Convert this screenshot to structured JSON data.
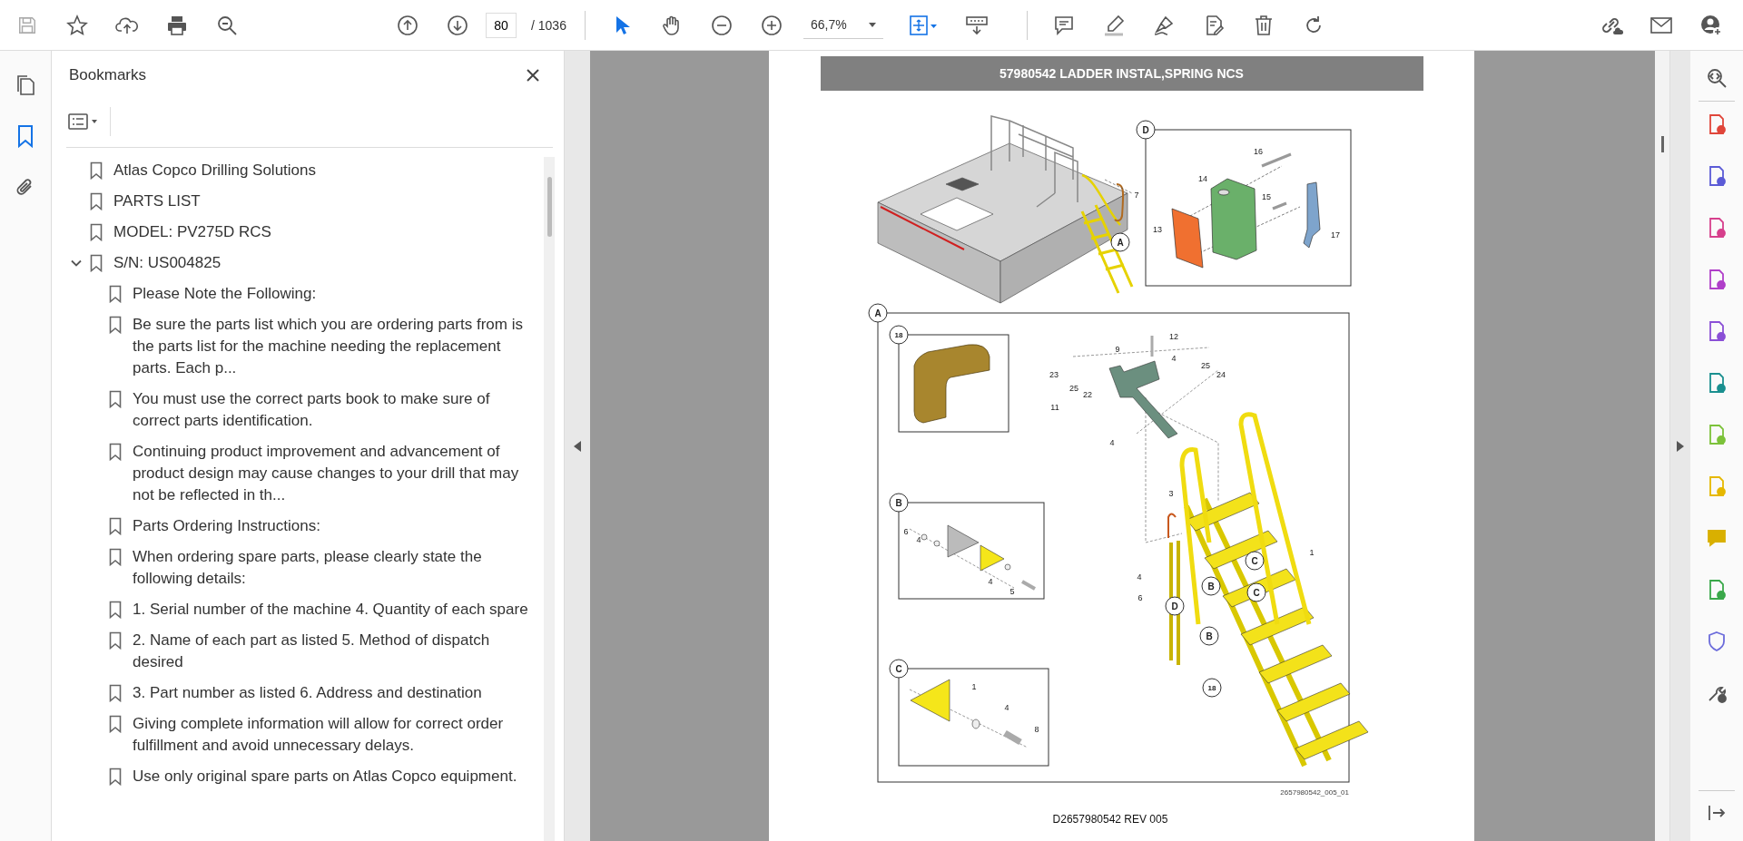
{
  "toolbar": {
    "page_number": "80",
    "page_total": "/ 1036",
    "zoom": "66,7%",
    "tools": [
      {
        "kind": "select",
        "selected": true
      },
      {
        "kind": "hand",
        "selected": false
      }
    ]
  },
  "nav_rail": [
    {
      "kind": "pages",
      "selected": false
    },
    {
      "kind": "bookmarks",
      "selected": true
    },
    {
      "kind": "attachments",
      "selected": false
    }
  ],
  "bookmarks_panel": {
    "title": "Bookmarks",
    "items": [
      {
        "label": "Atlas Copco Drilling Solutions"
      },
      {
        "label": "PARTS LIST"
      },
      {
        "label": "MODEL: PV275D RCS"
      },
      {
        "label": "S/N: US004825",
        "expanded": true,
        "children": [
          {
            "label": "Please Note the Following:"
          },
          {
            "label": "Be sure the parts list which you are ordering parts from is the parts list for the machine needing the replacement parts. Each p..."
          },
          {
            "label": "You must use the correct parts book to make sure of correct parts identification."
          },
          {
            "label": "Continuing product improvement and advancement of product design may cause changes to your drill that may not be reflected in th..."
          },
          {
            "label": "Parts Ordering Instructions:"
          },
          {
            "label": "When ordering spare parts, please clearly state the following details:"
          },
          {
            "label": "1. Serial number of the machine 4. Quantity of each spare"
          },
          {
            "label": "2. Name of each part as listed 5. Method of dispatch desired"
          },
          {
            "label": "3. Part number as listed 6. Address and destination"
          },
          {
            "label": "Giving complete information will allow for correct order fulfillment and avoid unnecessary delays."
          },
          {
            "label": "Use only original spare parts on Atlas Copco equipment."
          }
        ]
      }
    ]
  },
  "document": {
    "page_title": "57980542 LADDER INSTAL,SPRING NCS",
    "views": [
      {
        "kind": "machine",
        "callouts": [
          {
            "label": "7",
            "kind": "number"
          },
          {
            "label": "A",
            "kind": "circled"
          }
        ]
      },
      {
        "kind": "valve",
        "marker": "D",
        "callouts": [
          {
            "label": "16",
            "kind": "number"
          },
          {
            "label": "14",
            "kind": "number"
          },
          {
            "label": "15",
            "kind": "number"
          },
          {
            "label": "13",
            "kind": "number"
          },
          {
            "label": "17",
            "kind": "number"
          }
        ]
      },
      {
        "kind": "ladder",
        "marker": "A",
        "callouts": [
          {
            "label": "12",
            "kind": "number"
          },
          {
            "label": "9",
            "kind": "number"
          },
          {
            "label": "4",
            "kind": "number"
          },
          {
            "label": "25",
            "kind": "number"
          },
          {
            "label": "23",
            "kind": "number"
          },
          {
            "label": "24",
            "kind": "number"
          },
          {
            "label": "25",
            "kind": "number"
          },
          {
            "label": "22",
            "kind": "number"
          },
          {
            "label": "11",
            "kind": "number"
          },
          {
            "label": "4",
            "kind": "number"
          },
          {
            "label": "3",
            "kind": "number"
          },
          {
            "label": "1",
            "kind": "number"
          },
          {
            "label": "C",
            "kind": "circled"
          },
          {
            "label": "4",
            "kind": "number"
          },
          {
            "label": "B",
            "kind": "circled"
          },
          {
            "label": "C",
            "kind": "circled"
          },
          {
            "label": "6",
            "kind": "number"
          },
          {
            "label": "D",
            "kind": "circled"
          },
          {
            "label": "B",
            "kind": "circled"
          },
          {
            "label": "18",
            "kind": "circled"
          }
        ]
      },
      {
        "kind": "pad",
        "marker": "18"
      },
      {
        "kind": "plate_b",
        "marker": "B",
        "callouts": [
          {
            "label": "6",
            "kind": "number"
          },
          {
            "label": "4",
            "kind": "number"
          },
          {
            "label": "4",
            "kind": "number"
          },
          {
            "label": "5",
            "kind": "number"
          }
        ]
      },
      {
        "kind": "plate_c",
        "marker": "C",
        "callouts": [
          {
            "label": "1",
            "kind": "number"
          },
          {
            "label": "4",
            "kind": "number"
          },
          {
            "label": "8",
            "kind": "number"
          }
        ]
      }
    ],
    "drawing_number": "2657980542_005_01",
    "footer": "D2657980542 REV 005"
  }
}
